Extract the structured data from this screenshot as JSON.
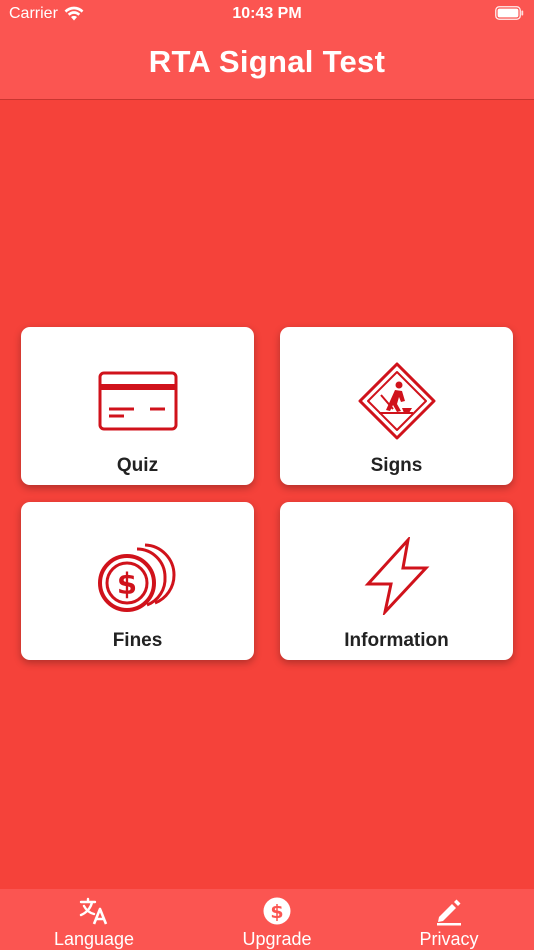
{
  "status_bar": {
    "carrier": "Carrier",
    "time": "10:43 PM"
  },
  "header": {
    "title": "RTA Signal Test"
  },
  "cards": [
    {
      "label": "Quiz",
      "icon": "credit-card-icon"
    },
    {
      "label": "Signs",
      "icon": "road-work-sign-icon"
    },
    {
      "label": "Fines",
      "icon": "coins-dollar-icon"
    },
    {
      "label": "Information",
      "icon": "lightning-bolt-icon"
    }
  ],
  "tabbar": {
    "items": [
      {
        "label": "Language",
        "icon": "translate-icon"
      },
      {
        "label": "Upgrade",
        "icon": "dollar-circle-icon"
      },
      {
        "label": "Privacy",
        "icon": "pencil-icon"
      }
    ]
  },
  "colors": {
    "background": "#f5423a",
    "header": "#fb5551",
    "icon_red": "#d0121b",
    "card": "#ffffff"
  }
}
